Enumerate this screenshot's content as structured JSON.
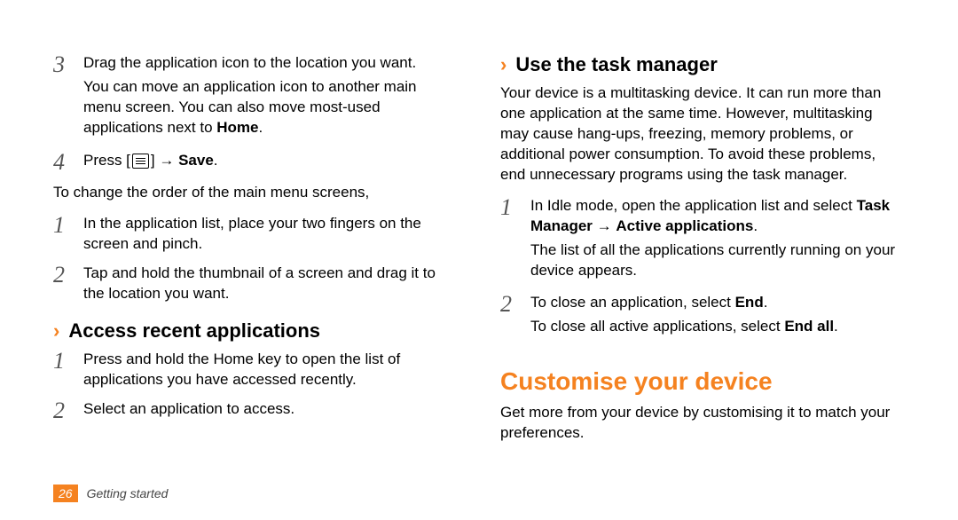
{
  "left": {
    "step3": {
      "num": "3",
      "p1": "Drag the application icon to the location you want.",
      "p2a": "You can move an application icon to another main menu screen. You can also move most-used applications next to ",
      "p2b": "Home",
      "p2c": "."
    },
    "step4": {
      "num": "4",
      "press": "Press [",
      "arrow": "] → ",
      "save": "Save",
      "dot": "."
    },
    "change": "To change the order of the main menu screens,",
    "c1": {
      "num": "1",
      "txt": "In the application list, place your two fingers on the screen and pinch."
    },
    "c2": {
      "num": "2",
      "txt": "Tap and hold the thumbnail of a screen and drag it to the location you want."
    },
    "recentHeading": "Access recent applications",
    "r1": {
      "num": "1",
      "txt": "Press and hold the Home key to open the list of applications you have accessed recently."
    },
    "r2": {
      "num": "2",
      "txt": "Select an application to access."
    }
  },
  "right": {
    "tmHeading": "Use the task manager",
    "tmIntro": "Your device is a multitasking device. It can run more than one application at the same time. However, multitasking may cause hang-ups, freezing, memory problems, or additional power consumption. To avoid these problems, end unnecessary programs using the task manager.",
    "t1": {
      "num": "1",
      "a": "In Idle mode, open the application list and select ",
      "b": "Task Manager",
      "c": " → ",
      "d": "Active applications",
      "e": ".",
      "p2": "The list of all the applications currently running on your device appears."
    },
    "t2": {
      "num": "2",
      "a": "To close an application, select ",
      "b": "End",
      "c": ".",
      "p2a": "To close all active applications, select ",
      "p2b": "End all",
      "p2c": "."
    },
    "custTitle": "Customise your device",
    "custText": "Get more from your device by customising it to match your preferences."
  },
  "footer": {
    "page": "26",
    "section": "Getting started"
  }
}
